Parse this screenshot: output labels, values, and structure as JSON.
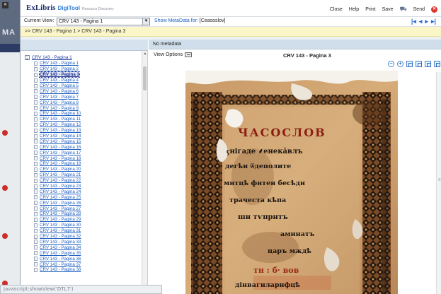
{
  "logo": {
    "brand": "ExLibris",
    "product": "DigiTool",
    "subtitle": "Resource Discovery"
  },
  "top_menu": [
    "Close",
    "Help",
    "Print",
    "Save",
    "Send"
  ],
  "view": {
    "label": "Current View:",
    "selected": "CRV 143 - Pagina 1",
    "metadata_link": "Show MetaData for:",
    "metadata_value": "[Ceasoslov]"
  },
  "breadcrumb": ">> CRV 143 - Pagina 1 > CRV 143 - Pagina 3",
  "tree": {
    "root": "CRV 143 - Pagina 1",
    "items": [
      "CRV 143 - Pagina 1",
      "CRV 143 - Pagina 2",
      "CRV 143 - Pagina 3",
      "CRV 143 - Pagina 4",
      "CRV 143 - Pagina 5",
      "CRV 143 - Pagina 6",
      "CRV 143 - Pagina 7",
      "CRV 143 - Pagina 8",
      "CRV 143 - Pagina 9",
      "CRV 143 - Pagina 10",
      "CRV 143 - Pagina 11",
      "CRV 143 - Pagina 12",
      "CRV 143 - Pagina 13",
      "CRV 143 - Pagina 14",
      "CRV 143 - Pagina 15",
      "CRV 143 - Pagina 16",
      "CRV 143 - Pagina 17",
      "CRV 143 - Pagina 18",
      "CRV 143 - Pagina 19",
      "CRV 143 - Pagina 20",
      "CRV 143 - Pagina 21",
      "CRV 143 - Pagina 22",
      "CRV 143 - Pagina 23",
      "CRV 143 - Pagina 24",
      "CRV 143 - Pagina 25",
      "CRV 143 - Pagina 26",
      "CRV 143 - Pagina 27",
      "CRV 143 - Pagina 28",
      "CRV 143 - Pagina 29",
      "CRV 143 - Pagina 30",
      "CRV 143 - Pagina 31",
      "CRV 143 - Pagina 32",
      "CRV 143 - Pagina 33",
      "CRV 143 - Pagina 34",
      "CRV 143 - Pagina 35",
      "CRV 143 - Pagina 36",
      "CRV 143 - Pagina 37",
      "CRV 143 - Pagina 38"
    ],
    "selected_index": 2
  },
  "main": {
    "metadata": "No metadata",
    "view_options": "View Options",
    "page_title": "CRV 143 - Pagina 3"
  },
  "scan_text": {
    "heading": "ЧАСОСЛОВ",
    "lines": [
      "ҁнігаде ⸙енекӑвлъ",
      "дегѣн ѿдеполите",
      "мнтцѣ фнтен бесѣдн",
      "трачеста кѣпа",
      "шн тѵпрнтъ",
      "аминатъ",
      "царъ мждѣ",
      "тн : б· вов",
      "дінвагнларнфцѣ"
    ]
  },
  "status_text": "javascript:showView('DTL7')",
  "colors": {
    "accent": "#2f6fd1",
    "breadcrumb_bg": "#fbf6c7",
    "header_bg": "#d6e3ef",
    "alert": "#d9342b"
  }
}
